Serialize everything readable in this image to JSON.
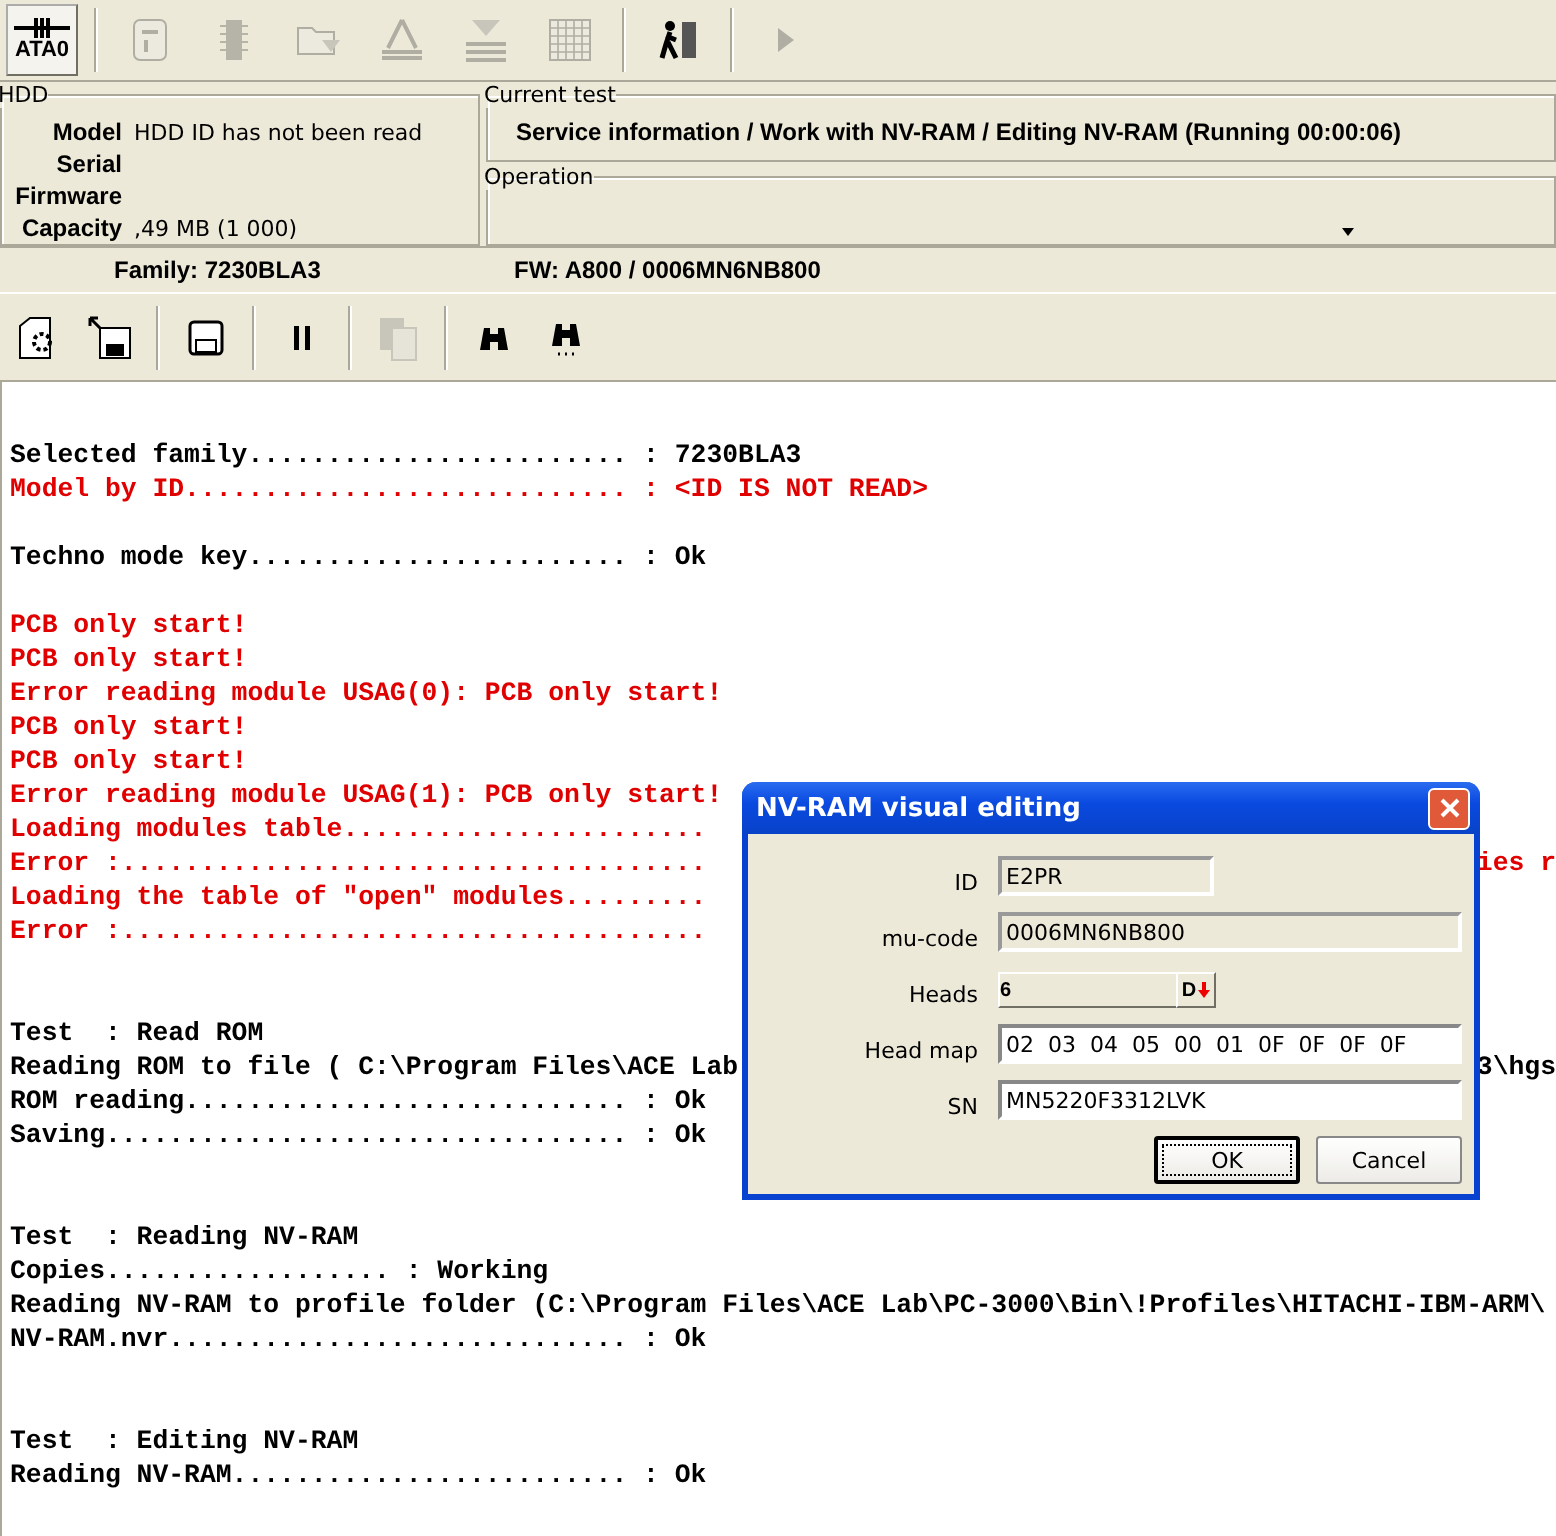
{
  "toolbar": [
    {
      "label": "ATA0",
      "pressed": true,
      "disabled": false
    },
    {
      "pressed": false,
      "disabled": true
    },
    {
      "pressed": false,
      "disabled": true
    },
    {
      "pressed": false,
      "disabled": true
    },
    {
      "pressed": false,
      "disabled": true
    },
    {
      "pressed": false,
      "disabled": true
    },
    {
      "pressed": false,
      "disabled": true
    },
    {
      "pressed": false,
      "disabled": false
    },
    {
      "pressed": false,
      "disabled": true
    }
  ],
  "hdd": {
    "title": "HDD",
    "fields": [
      {
        "label": "Model",
        "value": "HDD ID has not been read"
      },
      {
        "label": "Serial"
      },
      {
        "label": "Firmware"
      },
      {
        "label": "Capacity",
        "value": ",49 MB (1 000)"
      }
    ]
  },
  "current_test": {
    "title": "Current test",
    "value": "Service information / Work with NV-RAM / Editing NV-RAM (Running 00:00:06)"
  },
  "operation": {
    "title": "Operation"
  },
  "family": "Family: 7230BLA3",
  "fw": "FW: A800 / 0006MN6NB800",
  "actions": [
    {
      "disabled": false
    },
    {
      "disabled": false
    },
    {
      "disabled": false
    },
    {
      "disabled": false
    },
    {
      "disabled": true
    },
    {
      "disabled": false
    },
    {
      "disabled": false
    }
  ],
  "log": [
    {
      "kind": "normal",
      "text": "Selected family........................ : 7230BLA3"
    },
    {
      "kind": "error",
      "text": "Model by ID............................ : <ID IS NOT READ>"
    },
    {
      "kind": "blank"
    },
    {
      "kind": "normal",
      "text": "Techno mode key........................ : Ok"
    },
    {
      "kind": "blank"
    },
    {
      "kind": "error",
      "text": "PCB only start!"
    },
    {
      "kind": "error",
      "text": "PCB only start!"
    },
    {
      "kind": "error",
      "text": "Error reading module USAG(0): PCB only start!"
    },
    {
      "kind": "error",
      "text": "PCB only start!"
    },
    {
      "kind": "error",
      "text": "PCB only start!"
    },
    {
      "kind": "error",
      "text": "Error reading module USAG(1): PCB only start!"
    },
    {
      "kind": "error",
      "text": "Loading modules table......................."
    },
    {
      "kind": "error",
      "text": "Error :.....................................",
      "tail": "ies r"
    },
    {
      "kind": "error",
      "text": "Loading the table of \"open\" modules........."
    },
    {
      "kind": "error",
      "text": "Error :....................................."
    },
    {
      "kind": "blank"
    },
    {
      "kind": "blank"
    },
    {
      "kind": "normal",
      "text": "Test  : Read ROM"
    },
    {
      "kind": "normal",
      "text": "Reading ROM to file ( C:\\Program Files\\ACE Lab",
      "tail": "3\\hgs"
    },
    {
      "kind": "normal",
      "text": "ROM reading............................ : Ok"
    },
    {
      "kind": "normal",
      "text": "Saving................................. : Ok"
    },
    {
      "kind": "blank"
    },
    {
      "kind": "blank"
    },
    {
      "kind": "normal",
      "text": "Test  : Reading NV-RAM"
    },
    {
      "kind": "normal",
      "text": "Copies.................. : Working"
    },
    {
      "kind": "normal",
      "text": "Reading NV-RAM to profile folder (C:\\Program Files\\ACE Lab\\PC-3000\\Bin\\!Profiles\\HITACHI-IBM-ARM\\"
    },
    {
      "kind": "normal",
      "text": "NV-RAM.nvr............................. : Ok"
    },
    {
      "kind": "blank"
    },
    {
      "kind": "blank"
    },
    {
      "kind": "normal",
      "text": "Test  : Editing NV-RAM"
    },
    {
      "kind": "normal",
      "text": "Reading NV-RAM......................... : Ok"
    }
  ],
  "dialog": {
    "title": "NV-RAM visual editing",
    "fields": [
      {
        "label": "ID",
        "value": "E2PR",
        "readonly": true,
        "kind": "short"
      },
      {
        "label": "mu-code",
        "value": "0006MN6NB800",
        "readonly": true,
        "kind": "long"
      },
      {
        "label": "Heads",
        "value": "6",
        "readonly": false,
        "kind": "spin",
        "button": "D"
      },
      {
        "label": "Head map",
        "value": "02  03  04  05  00  01  0F  0F  0F  0F",
        "readonly": false,
        "kind": "long"
      },
      {
        "label": "SN",
        "value": "MN5220F3312LVK",
        "readonly": false,
        "kind": "long"
      }
    ],
    "buttons": [
      {
        "label": "OK",
        "focused": true
      },
      {
        "label": "Cancel",
        "focused": false
      }
    ]
  }
}
